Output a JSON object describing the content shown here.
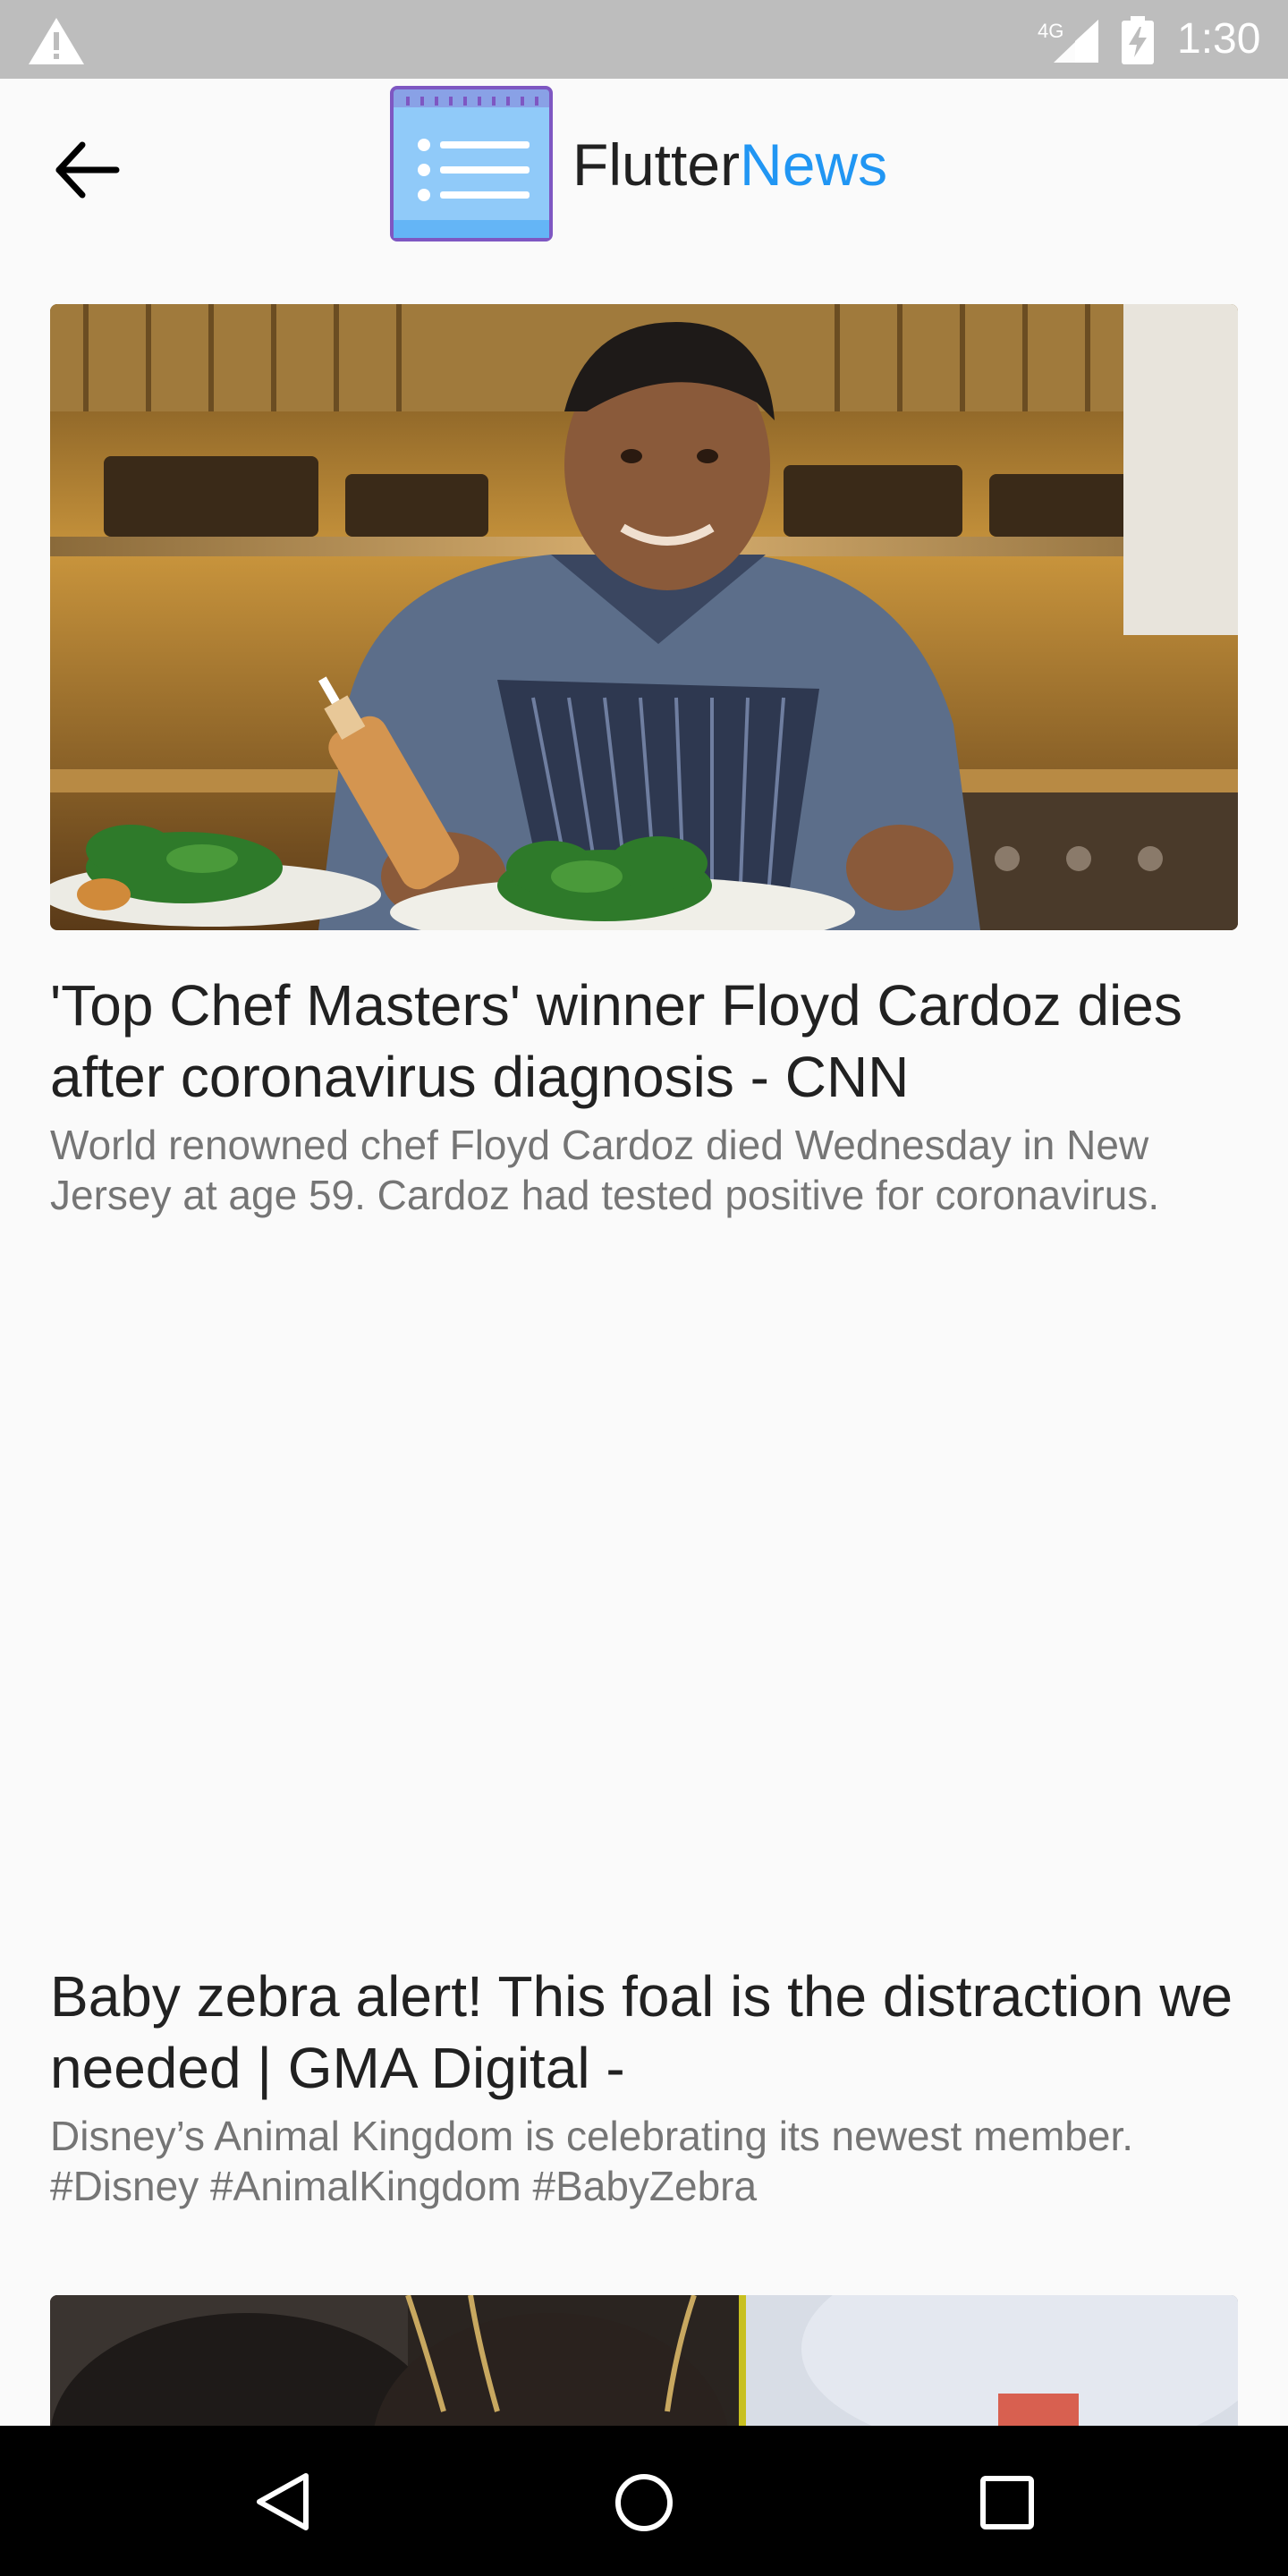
{
  "status_bar": {
    "network": "4G",
    "time": "1:30"
  },
  "app_bar": {
    "title_main": "Flutter",
    "title_accent": "News",
    "accent_color": "#2196f3",
    "back_icon": "arrow-back-icon",
    "logo_icon": "notepad-list-icon"
  },
  "articles": [
    {
      "title": "'Top Chef Masters' winner Floyd Cardoz dies after coronavirus diagnosis - CNN",
      "description": "World renowned chef Floyd Cardoz died Wednesday in New Jersey at age 59. Cardoz had tested positive for coronavirus.",
      "image": "chef-in-kitchen-photo"
    },
    {
      "title": "Baby zebra alert! This foal is the distraction we needed | GMA Digital -",
      "description": "Disney’s Animal Kingdom is celebrating its newest member. #Disney #AnimalKingdom #BabyZebra",
      "image": ""
    },
    {
      "image": "news-photo-partial"
    }
  ],
  "nav_bar": {
    "back": "triangle-back-icon",
    "home": "circle-home-icon",
    "recents": "square-recents-icon"
  }
}
